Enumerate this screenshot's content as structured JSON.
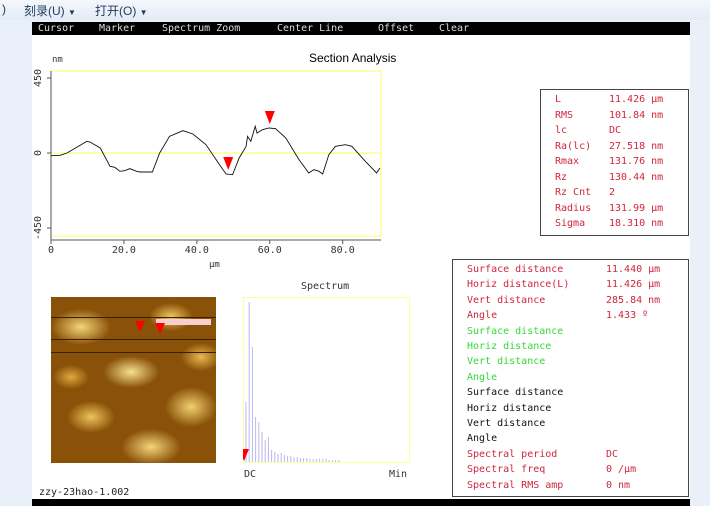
{
  "toolbar": {
    "left_fragment": ")",
    "burn": "刻录(U)",
    "open": "打开(O)"
  },
  "menu": [
    "Cursor",
    "Marker",
    "Spectrum Zoom",
    "Center Line",
    "Offset",
    "Clear"
  ],
  "title": "Section Analysis",
  "profile": {
    "ylabel": "nm",
    "xlabel": "µm",
    "yticks": [
      "450",
      "0",
      "-450"
    ],
    "xticks": [
      "0",
      "20.0",
      "40.0",
      "60.0",
      "80.0"
    ],
    "xlim": [
      0,
      90.5
    ],
    "ylim": [
      -450,
      450
    ],
    "points": [
      [
        0,
        -16
      ],
      [
        2.5,
        -14
      ],
      [
        4.4,
        0
      ],
      [
        9.8,
        70
      ],
      [
        10.7,
        66
      ],
      [
        13.5,
        30
      ],
      [
        16.2,
        -80
      ],
      [
        17.5,
        -86
      ],
      [
        18.9,
        -110
      ],
      [
        20.2,
        -106
      ],
      [
        21.6,
        -94
      ],
      [
        23.5,
        -110
      ],
      [
        24.4,
        -114
      ],
      [
        27.8,
        -114
      ],
      [
        29.8,
        0
      ],
      [
        32.5,
        100
      ],
      [
        36.2,
        134
      ],
      [
        38.9,
        114
      ],
      [
        42.5,
        50
      ],
      [
        46.2,
        -70
      ],
      [
        48,
        -126
      ],
      [
        49.8,
        -130
      ],
      [
        51.6,
        -30
      ],
      [
        53.5,
        40
      ],
      [
        53.9,
        100
      ],
      [
        54.8,
        70
      ],
      [
        56,
        160
      ],
      [
        56.5,
        120
      ],
      [
        58,
        140
      ],
      [
        59.8,
        150
      ],
      [
        61.6,
        146
      ],
      [
        64.4,
        90
      ],
      [
        68,
        -40
      ],
      [
        70.7,
        -120
      ],
      [
        72.1,
        -100
      ],
      [
        73.5,
        -110
      ],
      [
        74.5,
        -126
      ],
      [
        76.2,
        -10
      ],
      [
        78,
        40
      ],
      [
        80.7,
        50
      ],
      [
        82.5,
        40
      ],
      [
        86.2,
        -50
      ],
      [
        89.3,
        -120
      ],
      [
        90.2,
        -90
      ]
    ],
    "markers": [
      48.6,
      60.0
    ],
    "marker_color": "#ff0000",
    "axis_color": "#ffff66"
  },
  "stats": [
    [
      "L",
      "11.426 µm"
    ],
    [
      "RMS",
      "101.84 nm"
    ],
    [
      "lc",
      "DC"
    ],
    [
      "Ra(lc)",
      "27.518 nm"
    ],
    [
      "Rmax",
      "131.76 nm"
    ],
    [
      "Rz",
      "130.44 nm"
    ],
    [
      "Rz Cnt",
      "2"
    ],
    [
      "Radius",
      "131.99 µm"
    ],
    [
      "Sigma",
      "18.310 nm"
    ]
  ],
  "measurements": [
    {
      "label": "Surface distance",
      "value": "11.440 µm",
      "color": "red"
    },
    {
      "label": "Horiz distance(L)",
      "value": "11.426 µm",
      "color": "red"
    },
    {
      "label": "Vert distance",
      "value": "285.84 nm",
      "color": "red"
    },
    {
      "label": "Angle",
      "value": "1.433 º",
      "color": "red"
    },
    {
      "label": "Surface distance",
      "value": "",
      "color": "green"
    },
    {
      "label": "Horiz distance",
      "value": "",
      "color": "green"
    },
    {
      "label": "Vert distance",
      "value": "",
      "color": "green"
    },
    {
      "label": "Angle",
      "value": "",
      "color": "green"
    },
    {
      "label": "Surface distance",
      "value": "",
      "color": "black"
    },
    {
      "label": "Horiz distance",
      "value": "",
      "color": "black"
    },
    {
      "label": "Vert distance",
      "value": "",
      "color": "black"
    },
    {
      "label": "Angle",
      "value": "",
      "color": "black"
    },
    {
      "label": "Spectral period",
      "value": "DC",
      "color": "red"
    },
    {
      "label": "Spectral freq",
      "value": "0 /µm",
      "color": "red"
    },
    {
      "label": "Spectral RMS amp",
      "value": "0 nm",
      "color": "red"
    }
  ],
  "spectrum": {
    "title": "Spectrum",
    "left_label": "DC",
    "right_label": "Min"
  },
  "image_name": "zzy-23hao-1.002"
}
